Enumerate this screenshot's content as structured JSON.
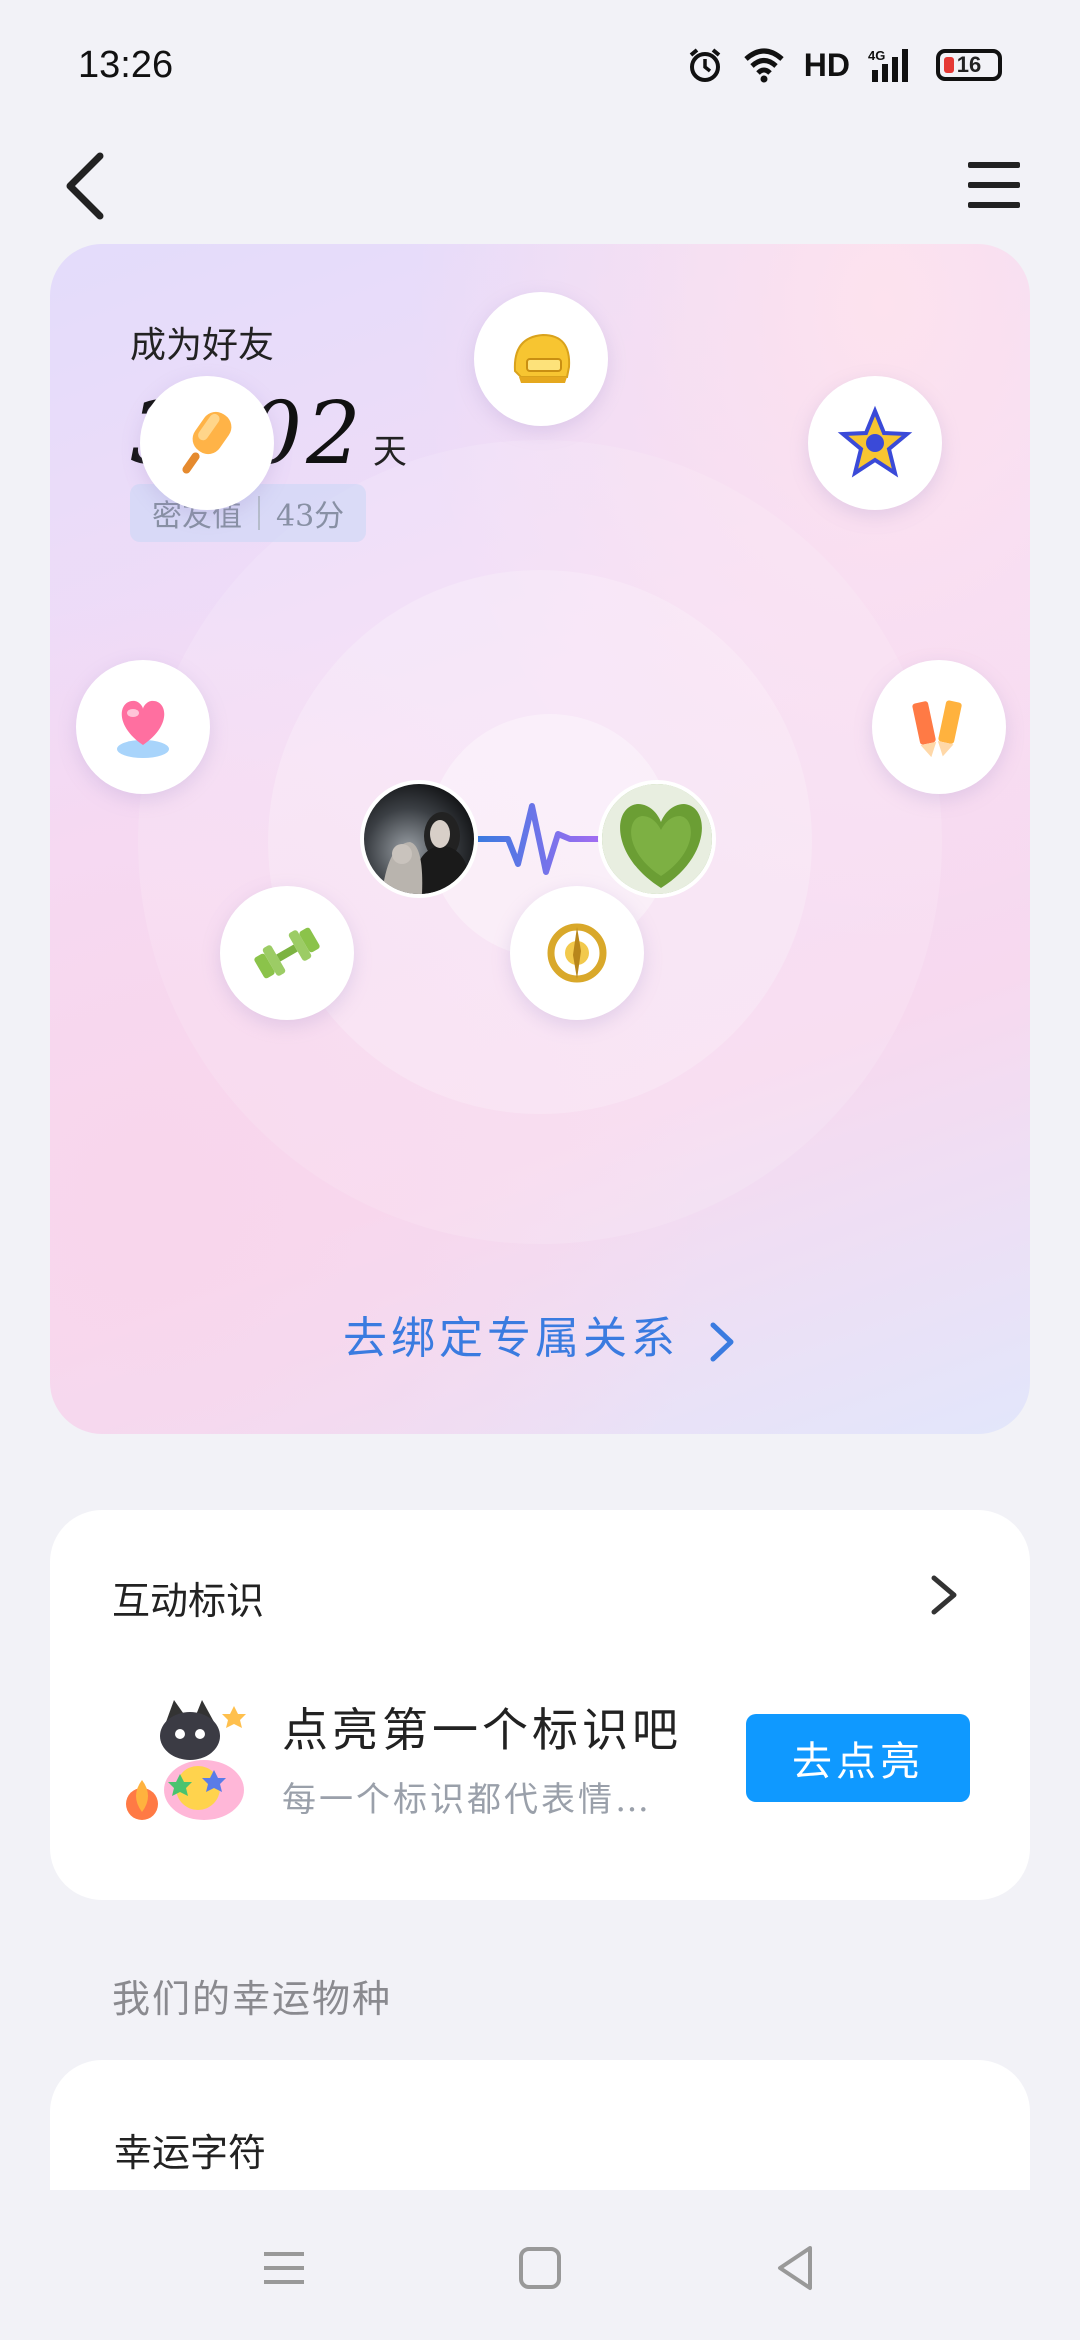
{
  "status_bar": {
    "time": "13:26",
    "network": "HD",
    "signal": "4G",
    "battery": "16",
    "icons": [
      "alarm-icon",
      "wifi-icon",
      "signal-icon",
      "battery-icon"
    ]
  },
  "nav": {
    "back_icon": "chevron-left-icon",
    "menu_icon": "hamburger-menu-icon"
  },
  "hero": {
    "friend_label": "成为好友",
    "days": "3902",
    "days_unit": "天",
    "intimacy_label": "密友值",
    "intimacy_value": "43分",
    "badges": [
      {
        "name": "helmet-badge"
      },
      {
        "name": "popsicle-badge"
      },
      {
        "name": "star-badge"
      },
      {
        "name": "heart-badge"
      },
      {
        "name": "pencils-badge"
      },
      {
        "name": "dumbbell-badge"
      },
      {
        "name": "compass-badge"
      }
    ],
    "bind_link": "去绑定专属关系"
  },
  "interaction": {
    "title": "互动标识",
    "main_text": "点亮第一个标识吧",
    "sub_text": "每一个标识都代表情…",
    "button_label": "去点亮"
  },
  "lucky": {
    "section_header": "我们的幸运物种",
    "card_title": "幸运字符"
  },
  "colors": {
    "accent_blue": "#0f99ff",
    "link_blue": "#3a7be0",
    "background": "#f2f2f7"
  }
}
